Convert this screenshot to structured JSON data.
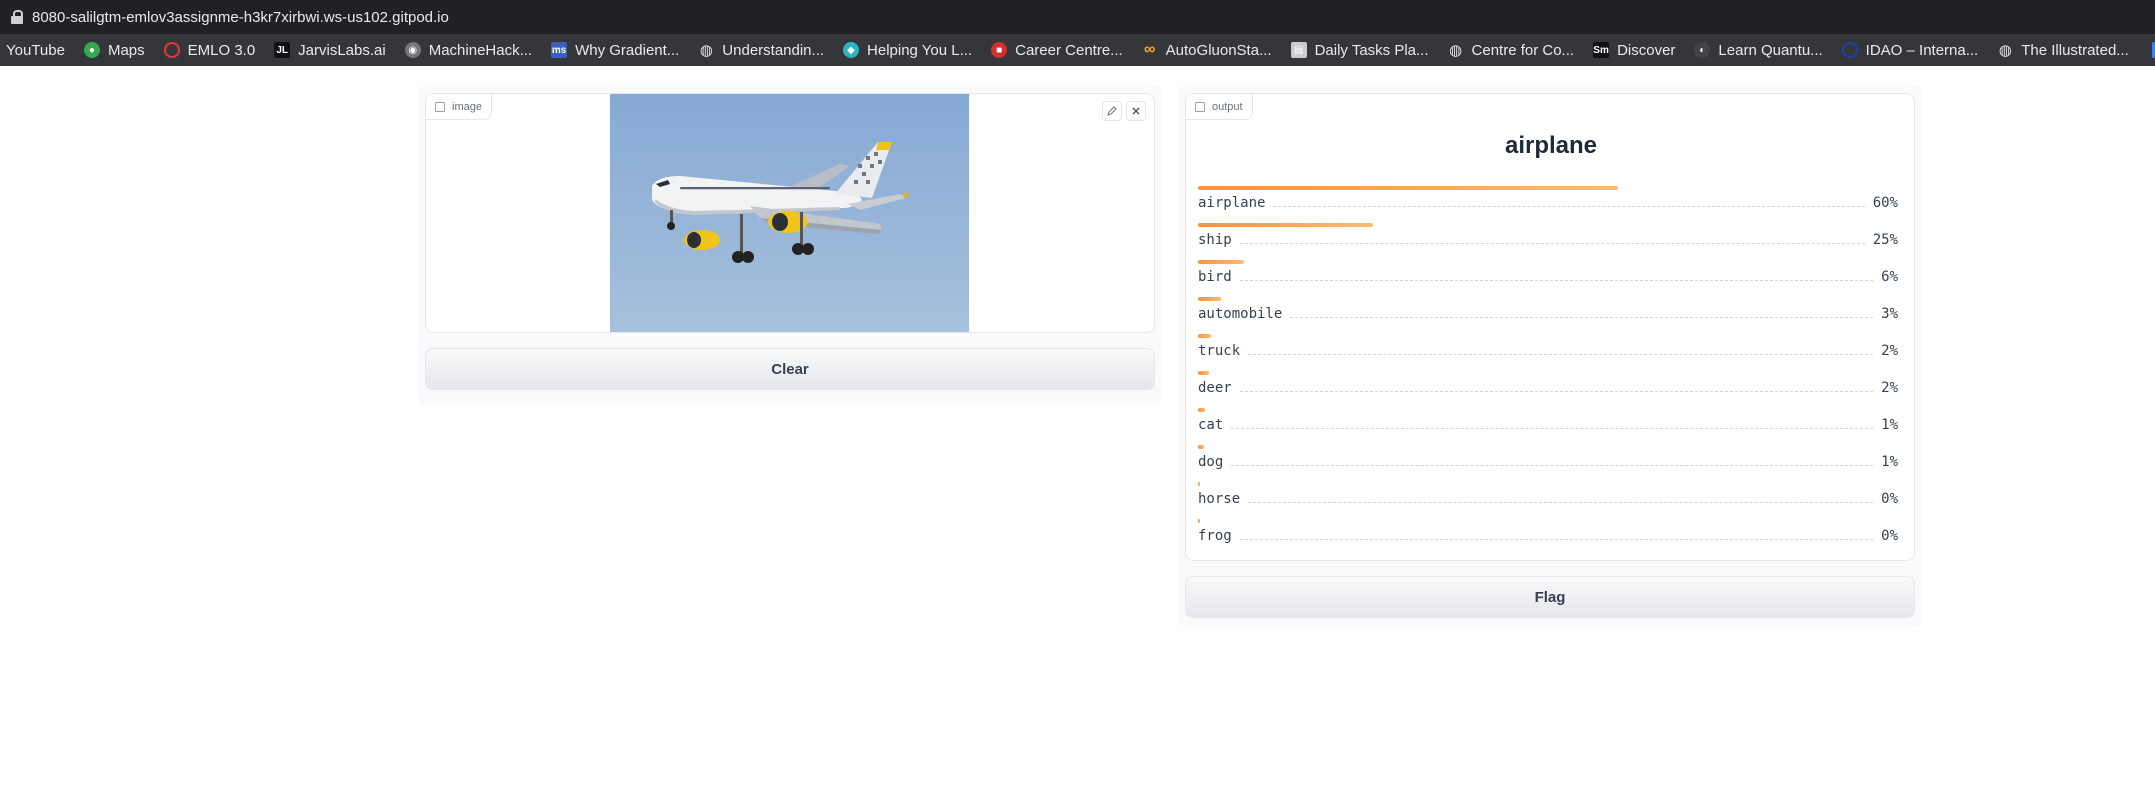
{
  "browser": {
    "url": "8080-salilgtm-emlov3assignme-h3kr7xirbwi.ws-us102.gitpod.io",
    "bookmarks": [
      {
        "label": "YouTube",
        "icon": "none",
        "color": ""
      },
      {
        "label": "Maps",
        "icon": "maps-pin-icon",
        "color": "#34a853"
      },
      {
        "label": "EMLO 3.0",
        "icon": "ring-icon",
        "color": "#e53935"
      },
      {
        "label": "JarvisLabs.ai",
        "icon": "jl-logo-icon",
        "color": "#111111"
      },
      {
        "label": "MachineHack...",
        "icon": "machinehack-logo-icon",
        "color": "#777777"
      },
      {
        "label": "Why Gradient...",
        "icon": "ms-logo-icon",
        "color": "#3b5fc0"
      },
      {
        "label": "Understandin...",
        "icon": "globe-icon",
        "color": "#9aa0a6"
      },
      {
        "label": "Helping You L...",
        "icon": "leaf-logo-icon",
        "color": "#2bb3c0"
      },
      {
        "label": "Career Centre...",
        "icon": "shield-logo-icon",
        "color": "#d32f2f"
      },
      {
        "label": "AutoGluonSta...",
        "icon": "infinity-icon",
        "color": "#f9a825"
      },
      {
        "label": "Daily Tasks Pla...",
        "icon": "notion-logo-icon",
        "color": "#cccccc"
      },
      {
        "label": "Centre for Co...",
        "icon": "globe-icon",
        "color": "#9aa0a6"
      },
      {
        "label": "Discover",
        "icon": "sm-logo-icon",
        "color": "#111111"
      },
      {
        "label": "Learn Quantu...",
        "icon": "quantum-logo-icon",
        "color": "#444444"
      },
      {
        "label": "IDAO – Interna...",
        "icon": "idao-ring-icon",
        "color": "#1e40af"
      },
      {
        "label": "The Illustrated...",
        "icon": "globe-icon",
        "color": "#9aa0a6"
      }
    ]
  },
  "input": {
    "label": "image",
    "image_alt": "airplane"
  },
  "buttons": {
    "clear": "Clear",
    "flag": "Flag"
  },
  "output": {
    "label": "output",
    "title": "airplane",
    "confidences": [
      {
        "label": "airplane",
        "value": "60%",
        "fraction": 0.6
      },
      {
        "label": "ship",
        "value": "25%",
        "fraction": 0.25
      },
      {
        "label": "bird",
        "value": "6%",
        "fraction": 0.065
      },
      {
        "label": "automobile",
        "value": "3%",
        "fraction": 0.033
      },
      {
        "label": "truck",
        "value": "2%",
        "fraction": 0.018
      },
      {
        "label": "deer",
        "value": "2%",
        "fraction": 0.016
      },
      {
        "label": "cat",
        "value": "1%",
        "fraction": 0.01
      },
      {
        "label": "dog",
        "value": "1%",
        "fraction": 0.009
      },
      {
        "label": "horse",
        "value": "0%",
        "fraction": 0.003
      },
      {
        "label": "frog",
        "value": "0%",
        "fraction": 0.002
      }
    ]
  },
  "colors": {
    "accent_orange": "#fb923c",
    "sky": "#8fb1d6"
  }
}
